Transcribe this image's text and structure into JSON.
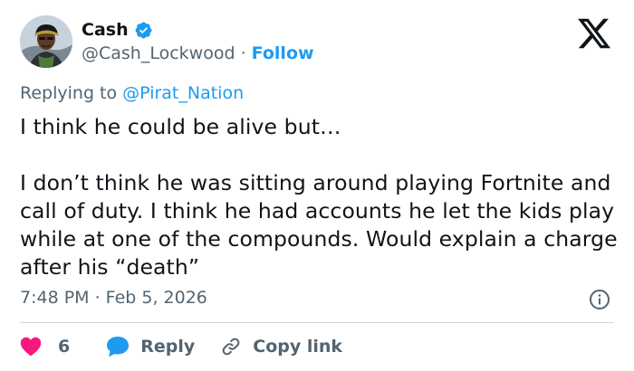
{
  "author": {
    "display_name": "Cash",
    "handle": "@Cash_Lockwood",
    "separator": " · ",
    "follow_label": "Follow"
  },
  "reply_context": {
    "prefix": "Replying to ",
    "mention": "@Pirat_Nation"
  },
  "tweet": {
    "text": "I think he could be alive but…\n\nI don’t think he was sitting around playing Fortnite and call of duty. I think he had accounts he let the kids play while at one of the compounds. Would explain a charge after his “death”",
    "timestamp": "7:48 PM · Feb 5, 2026"
  },
  "actions": {
    "like_count": "6",
    "reply_label": "Reply",
    "copy_label": "Copy link"
  },
  "colors": {
    "accent": "#1d9bf0",
    "like": "#f91880",
    "muted": "#536471",
    "text": "#0f1419"
  },
  "icons": [
    "avatar",
    "verified-badge-icon",
    "x-logo-icon",
    "info-icon",
    "heart-icon",
    "reply-bubble-icon",
    "link-icon"
  ]
}
